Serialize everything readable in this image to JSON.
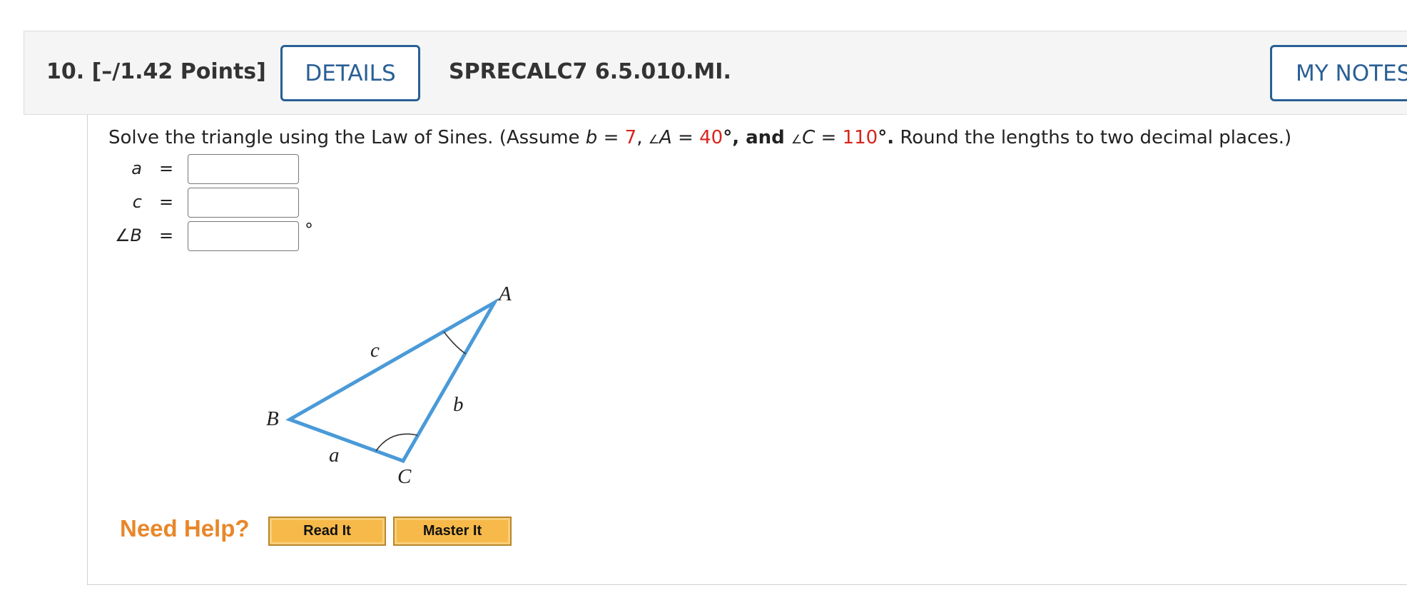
{
  "header": {
    "question_label": "10.  [–/1.42 Points]",
    "details_label": "DETAILS",
    "question_code": "SPRECALC7 6.5.010.MI.",
    "notes_label": "MY NOTES"
  },
  "prompt": {
    "lead": "Solve the triangle using the Law of Sines. (Assume ",
    "b_var": "b",
    "b_eq": " = ",
    "b_val": "7",
    "sep1": ",   ",
    "angle_symbol": "∠",
    "A_var": "A",
    "A_eq": " = ",
    "A_val": "40",
    "deg1": "°,  and  ",
    "C_var": "C",
    "C_eq": " = ",
    "C_val": "110",
    "deg2": "°.",
    "tail": " Round the lengths to two decimal places.)"
  },
  "answers": [
    {
      "label": "a",
      "equals": "=",
      "value": ""
    },
    {
      "label": "c",
      "equals": "=",
      "value": ""
    },
    {
      "label": "∠B",
      "equals": "=",
      "value": "",
      "unit": "°"
    }
  ],
  "figure": {
    "vertex_A": "A",
    "vertex_B": "B",
    "vertex_C": "C",
    "side_a": "a",
    "side_b": "b",
    "side_c": "c",
    "line_color": "#4a9ad8"
  },
  "help": {
    "label": "Need Help?",
    "read_it": "Read It",
    "master_it": "Master It"
  }
}
